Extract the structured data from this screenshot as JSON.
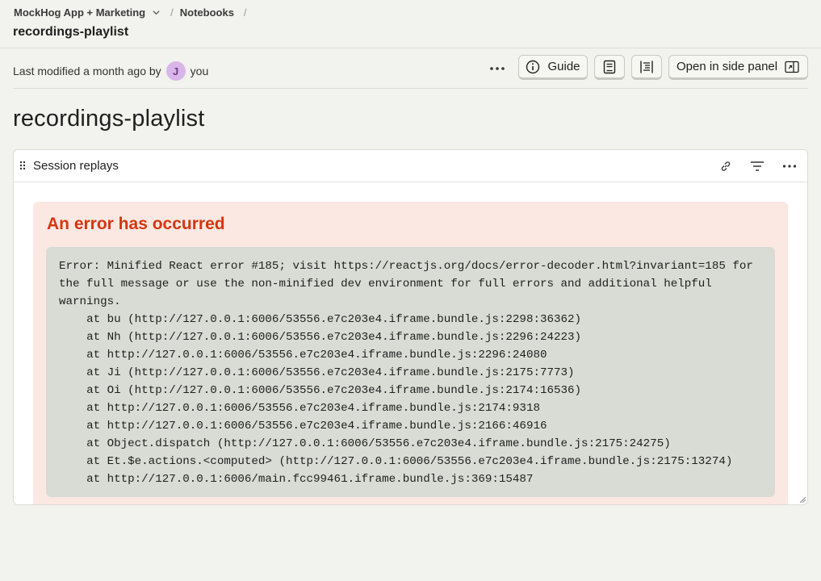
{
  "breadcrumb": {
    "project": "MockHog App + Marketing",
    "section": "Notebooks",
    "separator": "/"
  },
  "page": {
    "name": "recordings-playlist"
  },
  "meta": {
    "modified_text": "Last modified a month ago by",
    "avatar_initial": "J",
    "user": "you"
  },
  "toolbar": {
    "guide_label": "Guide",
    "side_panel_label": "Open in side panel"
  },
  "notebook": {
    "title": "recordings-playlist"
  },
  "card": {
    "title": "Session replays",
    "error_heading": "An error has occurred",
    "error_text": "Error: Minified React error #185; visit https://reactjs.org/docs/error-decoder.html?invariant=185 for the full message or use the non-minified dev environment for full errors and additional helpful warnings.\n    at bu (http://127.0.0.1:6006/53556.e7c203e4.iframe.bundle.js:2298:36362)\n    at Nh (http://127.0.0.1:6006/53556.e7c203e4.iframe.bundle.js:2296:24223)\n    at http://127.0.0.1:6006/53556.e7c203e4.iframe.bundle.js:2296:24080\n    at Ji (http://127.0.0.1:6006/53556.e7c203e4.iframe.bundle.js:2175:7773)\n    at Oi (http://127.0.0.1:6006/53556.e7c203e4.iframe.bundle.js:2174:16536)\n    at http://127.0.0.1:6006/53556.e7c203e4.iframe.bundle.js:2174:9318\n    at http://127.0.0.1:6006/53556.e7c203e4.iframe.bundle.js:2166:46916\n    at Object.dispatch (http://127.0.0.1:6006/53556.e7c203e4.iframe.bundle.js:2175:24275)\n    at Et.$e.actions.<computed> (http://127.0.0.1:6006/53556.e7c203e4.iframe.bundle.js:2175:13274)\n    at http://127.0.0.1:6006/main.fcc99461.iframe.bundle.js:369:15487"
  },
  "colors": {
    "background": "#f2f2ee",
    "error_heading": "#d4360f",
    "error_background": "#fbe8e3",
    "code_background": "#d9dcd5",
    "avatar": "#d9b6ea"
  },
  "icons": [
    "chevron-down-icon",
    "more-icon",
    "info-icon",
    "notebook-icon",
    "table-of-contents-icon",
    "side-panel-icon",
    "drag-handle-icon",
    "link-icon",
    "filter-icon",
    "resize-grip-icon"
  ]
}
